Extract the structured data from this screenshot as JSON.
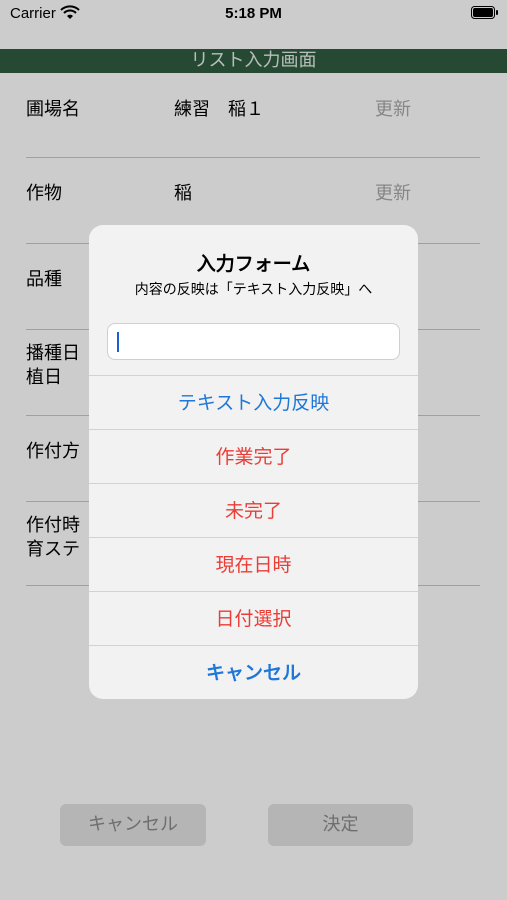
{
  "status_bar": {
    "carrier": "Carrier",
    "time": "5:18 PM"
  },
  "title": "リスト入力画面",
  "rows": [
    {
      "label": "圃場名",
      "value": "練習　稲１",
      "update": "更新"
    },
    {
      "label": "作物",
      "value": "稲",
      "update": "更新"
    },
    {
      "label": "品種"
    },
    {
      "label_line1": "播種日",
      "label_line2": "植日"
    },
    {
      "label": "作付方"
    },
    {
      "label_line1": "作付時",
      "label_line2": "育ステ"
    }
  ],
  "bottom": {
    "cancel_label": "キャンセル",
    "ok_label": "決定"
  },
  "alert": {
    "title": "入力フォーム",
    "message": "内容の反映は「テキスト入力反映」へ",
    "input_value": "",
    "actions": [
      "テキスト入力反映",
      "作業完了",
      "未完了",
      "現在日時",
      "日付選択",
      "キャンセル"
    ]
  },
  "colors": {
    "title_bar": "#2f5c40",
    "action_blue": "#1f77d8",
    "action_red": "#ea3d37"
  }
}
